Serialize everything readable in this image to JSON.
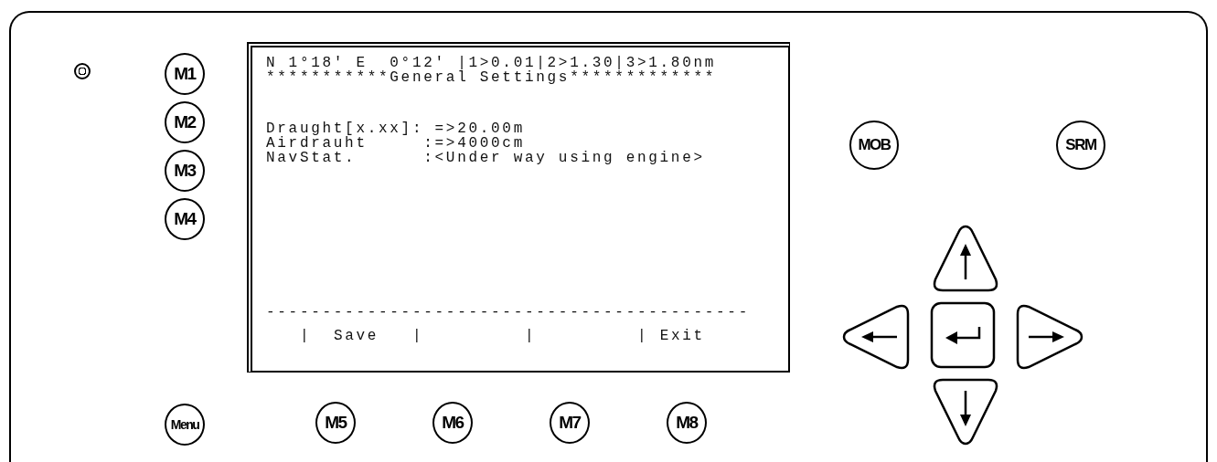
{
  "side_keys": [
    "M1",
    "M2",
    "M3",
    "M4"
  ],
  "menu_key": "Menu",
  "bottom_keys": [
    "M5",
    "M6",
    "M7",
    "M8"
  ],
  "top_right_keys": [
    "MOB",
    "SRM"
  ],
  "screen": {
    "header_lines": [
      "N 1°18' E  0°12' |1>0.01|2>1.30|3>1.80nm",
      "***********General Settings*************"
    ],
    "settings_lines": [
      "Draught[x.xx]: =>20.00m",
      "Airdrauht     :=>4000cm",
      "NavStat.      :<Under way using engine>"
    ],
    "divider": "-------------------------------------------",
    "softkey_bar": "|  Save   |         |         | Exit"
  }
}
